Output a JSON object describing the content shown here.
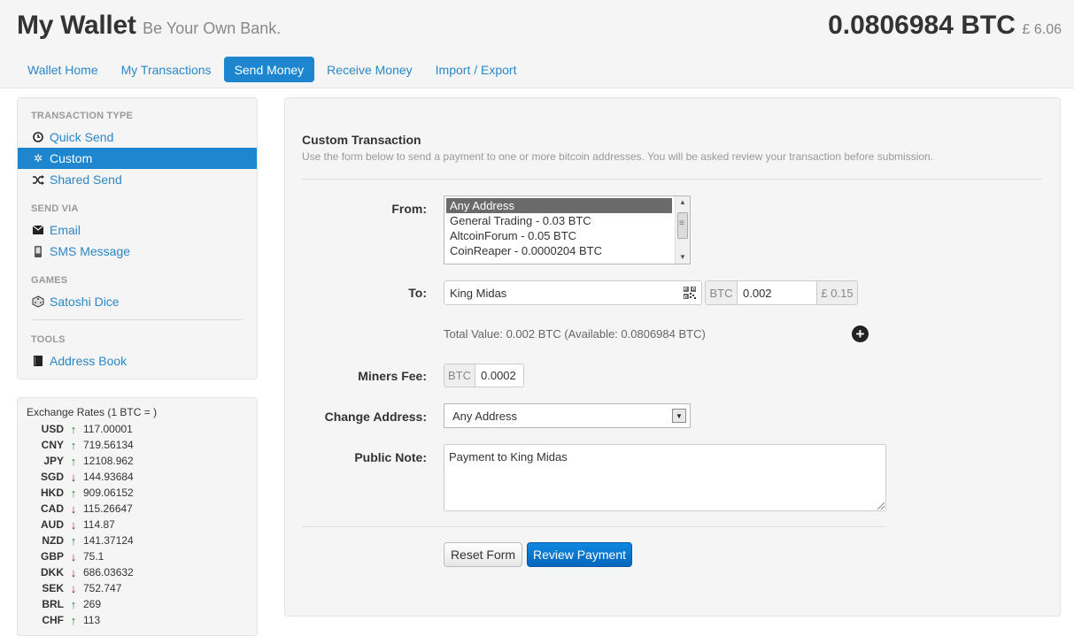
{
  "header": {
    "title": "My Wallet",
    "tagline": "Be Your Own Bank.",
    "balance_btc": "0.0806984 BTC",
    "balance_fiat": "£ 6.06"
  },
  "nav": {
    "tabs": [
      {
        "label": "Wallet Home"
      },
      {
        "label": "My Transactions"
      },
      {
        "label": "Send Money",
        "active": true
      },
      {
        "label": "Receive Money"
      },
      {
        "label": "Import / Export"
      }
    ]
  },
  "sidebar": {
    "transaction_type_heading": "Transaction Type",
    "transaction_types": [
      {
        "label": "Quick Send",
        "icon": "clock-icon"
      },
      {
        "label": "Custom",
        "icon": "gear-icon",
        "active": true
      },
      {
        "label": "Shared Send",
        "icon": "shuffle-icon"
      }
    ],
    "send_via_heading": "Send Via",
    "send_via": [
      {
        "label": "Email",
        "icon": "envelope-icon"
      },
      {
        "label": "SMS Message",
        "icon": "phone-icon"
      }
    ],
    "games_heading": "Games",
    "games": [
      {
        "label": "Satoshi Dice",
        "icon": "dice-icon"
      }
    ],
    "tools_heading": "Tools",
    "tools": [
      {
        "label": "Address Book",
        "icon": "book-icon"
      }
    ]
  },
  "rates": {
    "title": "Exchange Rates (1 BTC = )",
    "items": [
      {
        "currency": "USD",
        "direction": "up",
        "value": "117.00001"
      },
      {
        "currency": "CNY",
        "direction": "up",
        "value": "719.56134"
      },
      {
        "currency": "JPY",
        "direction": "up",
        "value": "12108.962"
      },
      {
        "currency": "SGD",
        "direction": "down",
        "value": "144.93684"
      },
      {
        "currency": "HKD",
        "direction": "up",
        "value": "909.06152"
      },
      {
        "currency": "CAD",
        "direction": "down",
        "value": "115.26647"
      },
      {
        "currency": "AUD",
        "direction": "down",
        "value": "114.87"
      },
      {
        "currency": "NZD",
        "direction": "up",
        "value": "141.37124"
      },
      {
        "currency": "GBP",
        "direction": "down",
        "value": "75.1"
      },
      {
        "currency": "DKK",
        "direction": "down",
        "value": "686.03632"
      },
      {
        "currency": "SEK",
        "direction": "down",
        "value": "752.747"
      },
      {
        "currency": "BRL",
        "direction": "up",
        "value": "269"
      },
      {
        "currency": "CHF",
        "direction": "up",
        "value": "113"
      }
    ]
  },
  "form": {
    "title": "Custom Transaction",
    "description": "Use the form below to send a payment to one or more bitcoin addresses. You will be asked review your transaction before submission.",
    "from_label": "From:",
    "from_options": [
      {
        "label": "Any Address",
        "selected": true
      },
      {
        "label": "General Trading - 0.03 BTC"
      },
      {
        "label": "AltcoinForum - 0.05 BTC"
      },
      {
        "label": "CoinReaper - 0.0000204 BTC"
      }
    ],
    "to_label": "To:",
    "to_value": "King Midas",
    "to_currency": "BTC",
    "amount_value": "0.002",
    "fiat_value": "£ 0.15",
    "total_value": "Total Value: 0.002 BTC (Available: 0.0806984 BTC)",
    "fee_label": "Miners Fee:",
    "fee_currency": "BTC",
    "fee_value": "0.0002",
    "change_label": "Change Address:",
    "change_value": "Any Address",
    "note_label": "Public Note:",
    "note_value": "Payment to King Midas",
    "reset_label": "Reset Form",
    "review_label": "Review Payment"
  },
  "colors": {
    "accent": "#1d86ce",
    "link": "#2a87c8",
    "rate_up": "#2e7d32",
    "rate_down": "#8b1a1a"
  }
}
